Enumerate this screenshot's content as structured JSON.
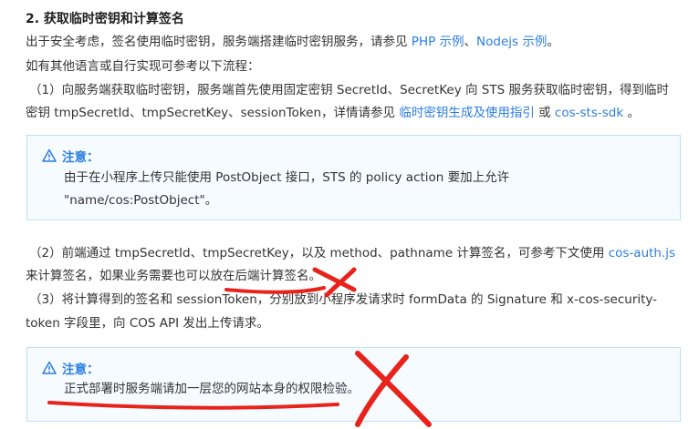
{
  "heading": "2. 获取临时密钥和计算签名",
  "p1": {
    "text": "出于安全考虑，签名使用临时密钥，服务端搭建临时密钥服务，请参见 ",
    "link1": "PHP 示例",
    "sep": "、",
    "link2": "Nodejs 示例",
    "end": "。"
  },
  "p2": "如有其他语言或自行实现可参考以下流程：",
  "step1": {
    "line1": "（1）向服务端获取临时密钥，服务端首先使用固定密钥 SecretId、SecretKey 向 STS 服务获取临时密钥，得到临时",
    "line2_text": "密钥 tmpSecretId、tmpSecretKey、sessionToken，详情请参见 ",
    "link1": "临时密钥生成及使用指引",
    "or": " 或 ",
    "link2": "cos-sts-sdk",
    "end": " 。"
  },
  "note1": {
    "title": "注意：",
    "line1": "由于在小程序上传只能使用 PostObject 接口，STS 的 policy action 要加上允许",
    "line2": "\"name/cos:PostObject\"。"
  },
  "step2": {
    "line1_text": "（2）前端通过 tmpSecretId、tmpSecretKey，以及 method、pathname 计算签名，可参考下文使用 ",
    "link": "cos-auth.js",
    "line2": "来计算签名，如果业务需要也可以放在后端计算签名。"
  },
  "step3": {
    "line1": "（3）将计算得到的签名和 sessionToken，分别放到小程序发请求时 formData 的 Signature 和 x-cos-security-",
    "line2": "token 字段里，向 COS API 发出上传请求。"
  },
  "note2": {
    "title": "注意：",
    "line1": "正式部署时服务端请加一层您的网站本身的权限检验。"
  },
  "colors": {
    "link": "#2b7de0",
    "annotation": "#e8231c",
    "note_border": "#bfe0f5"
  },
  "icons": {
    "note": "warning-triangle-icon"
  }
}
